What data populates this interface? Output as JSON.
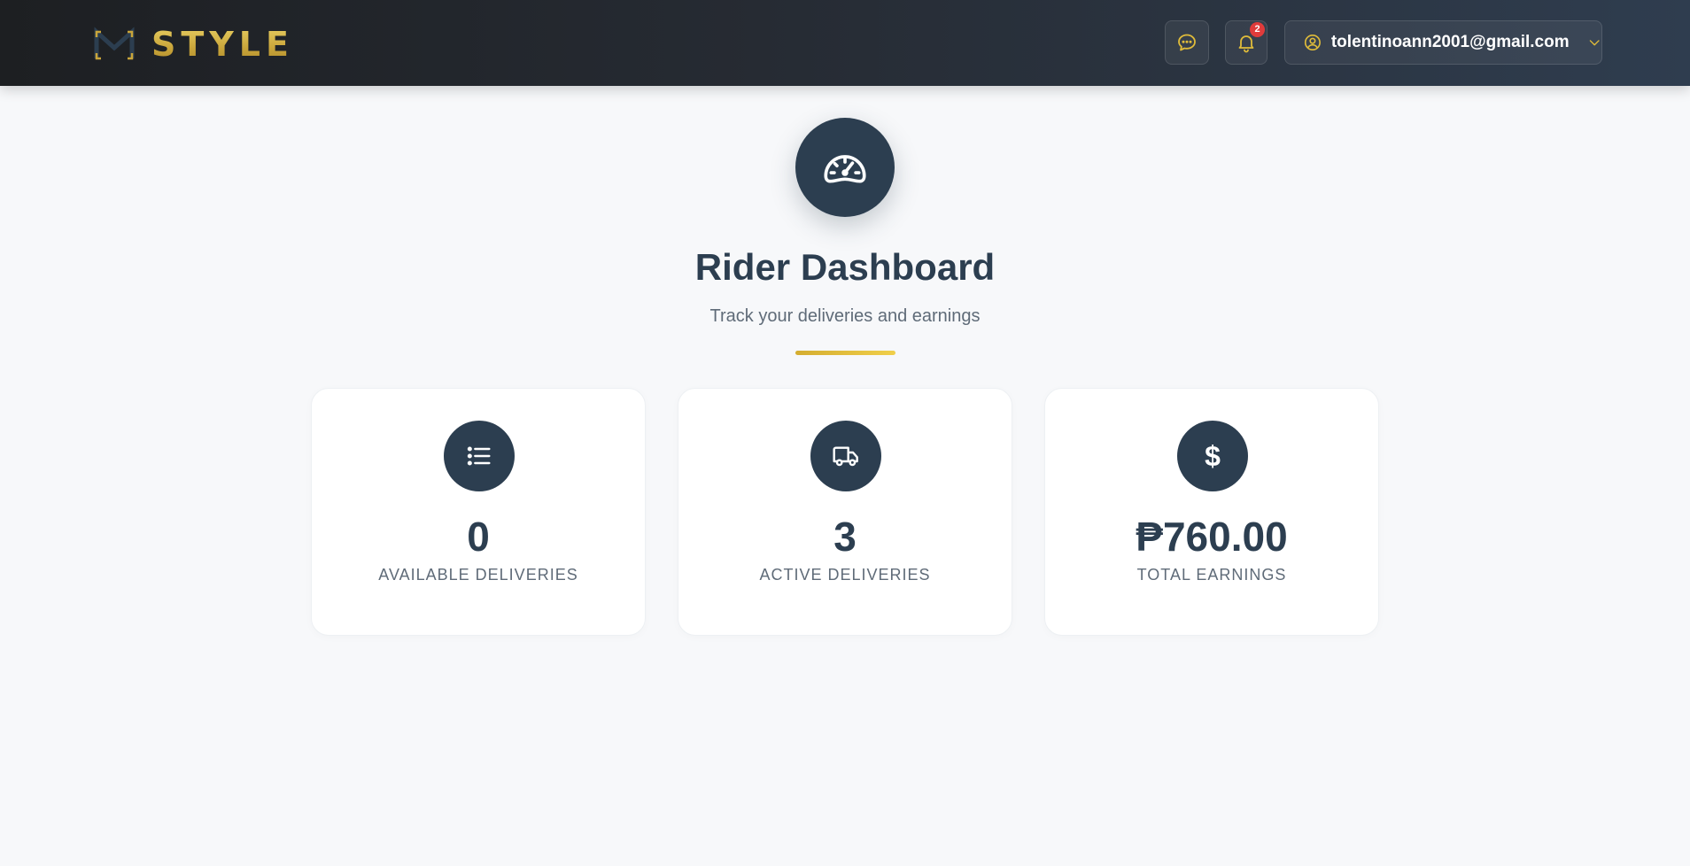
{
  "header": {
    "brand_name": "STYLE",
    "notification_count": "2",
    "user_email": "tolentinoann2001@gmail.com"
  },
  "hero": {
    "icon": "speedometer-icon",
    "title": "Rider Dashboard",
    "subtitle": "Track your deliveries and earnings"
  },
  "stats": [
    {
      "icon": "list-icon",
      "value": "0",
      "label": "AVAILABLE DELIVERIES"
    },
    {
      "icon": "truck-icon",
      "value": "3",
      "label": "ACTIVE DELIVERIES"
    },
    {
      "icon": "dollar-icon",
      "value": "₱760.00",
      "label": "TOTAL EARNINGS"
    }
  ],
  "colors": {
    "primary": "#2c3e50",
    "accent_gold": "#e0bc3a",
    "badge_red": "#e03b3b",
    "background": "#f7f8fa"
  }
}
